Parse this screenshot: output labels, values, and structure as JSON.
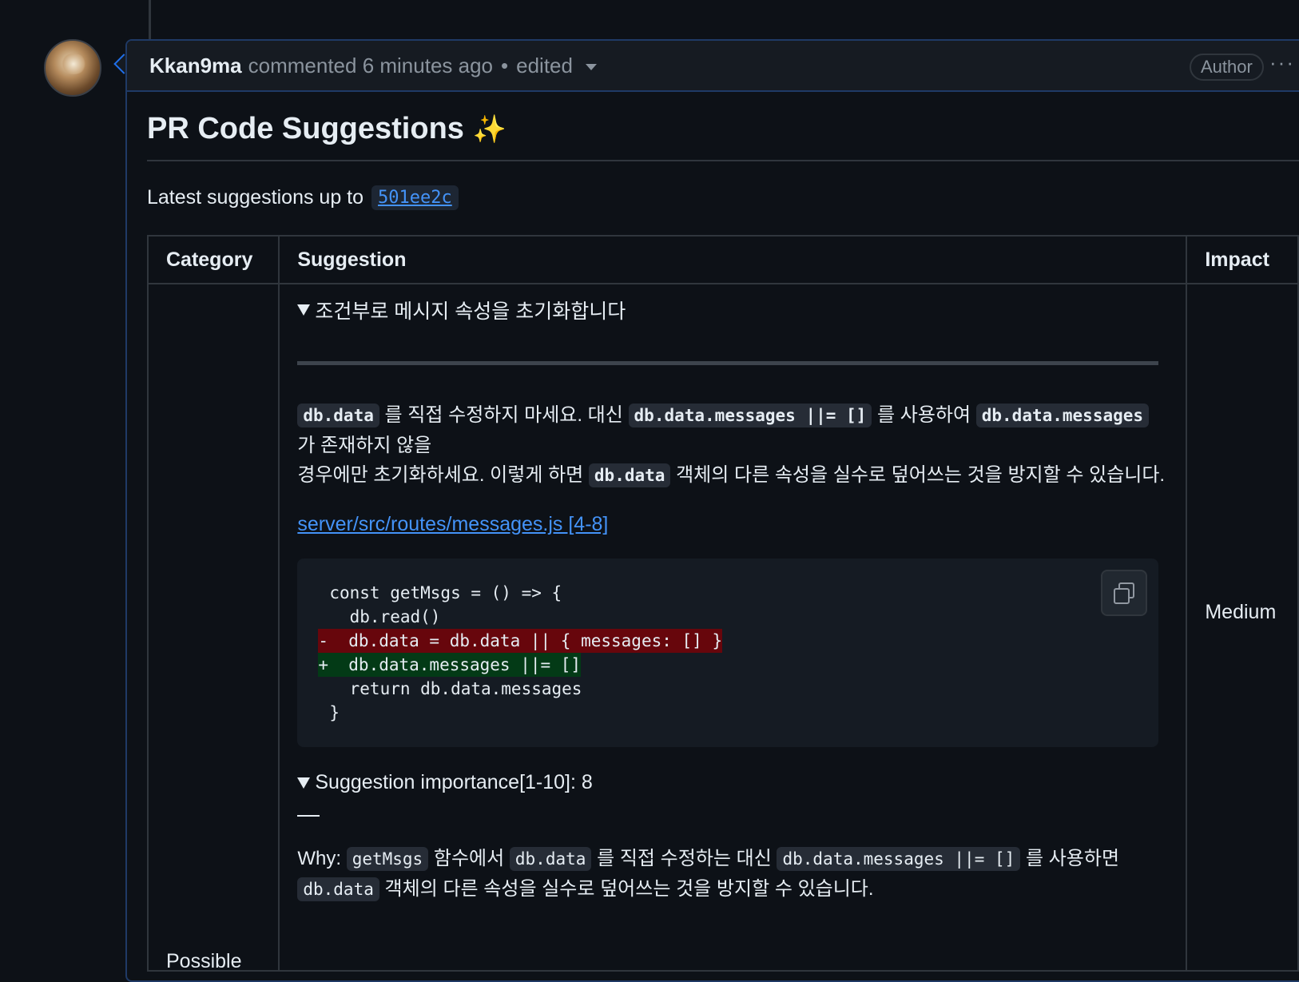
{
  "comment": {
    "author": "Kkan9ma",
    "action": "commented 6 minutes ago",
    "edited": "edited",
    "badge": "Author",
    "more": "···"
  },
  "body": {
    "title": "PR Code Suggestions",
    "title_emoji": "✨",
    "latest_prefix": "Latest suggestions up to",
    "sha": "501ee2c"
  },
  "table": {
    "headers": {
      "category": "Category",
      "suggestion": "Suggestion",
      "impact": "Impact"
    },
    "row": {
      "category": "Possible",
      "impact": "Medium",
      "summary": "조건부로 메시지 속성을 초기화합니다",
      "p1": {
        "c1": "db.data",
        "t1": "를 직접 수정하지 마세요. 대신",
        "c2": "db.data.messages ||= []",
        "t2": "를 사용하여",
        "c3": "db.data.messages",
        "t3": "가 존재하지 않을",
        "t4": "경우에만 초기화하세요. 이렇게 하면",
        "c4": "db.data",
        "t5": "객체의 다른 속성을 실수로 덮어쓰는 것을 방지할 수 있습니다."
      },
      "file_link": "server/src/routes/messages.js [4-8]",
      "code": [
        "const getMsgs = () => {",
        "  db.read()",
        "-  db.data = db.data || { messages: [] }",
        "+  db.data.messages ||= []",
        "  return db.data.messages",
        "}"
      ],
      "importance": "Suggestion importance[1-10]: 8",
      "dash": "—",
      "why": {
        "label": "Why:",
        "c1": "getMsgs",
        "t1": "함수에서",
        "c2": "db.data",
        "t2": "를 직접 수정하는 대신",
        "c3": "db.data.messages ||= []",
        "t3": "를 사용하면",
        "c4": "db.data",
        "t4": "객체의 다른 속성을 실수로 덮어쓰는 것을 방지할 수 있습니다."
      }
    }
  }
}
